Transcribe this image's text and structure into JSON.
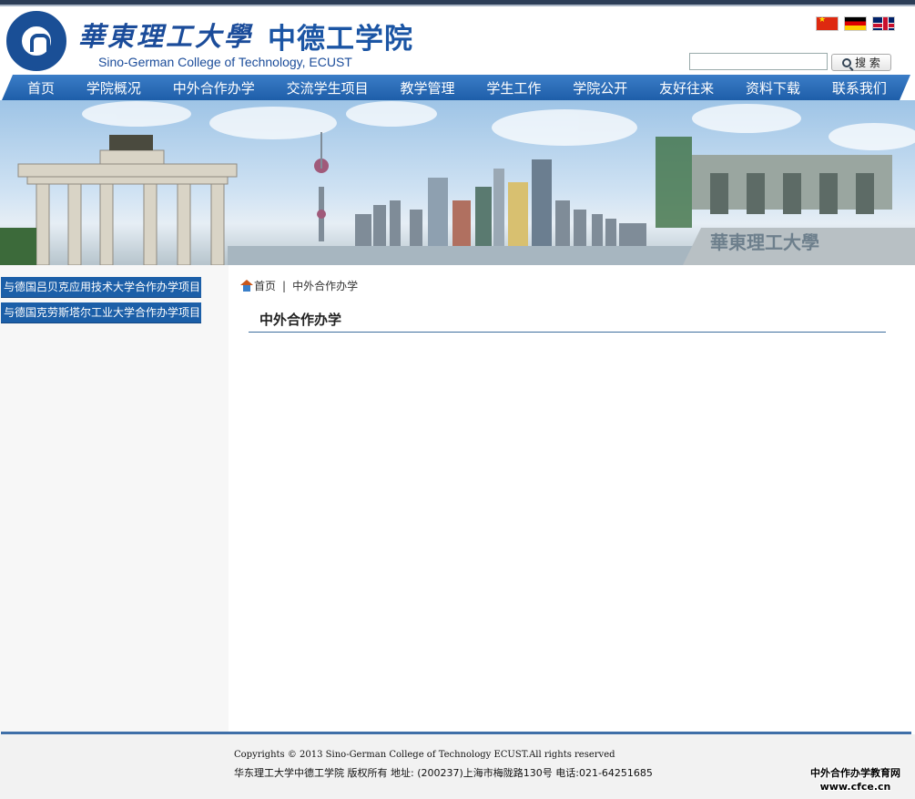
{
  "header": {
    "school_name": "華東理工大學",
    "college_name_cn": "中德工学院",
    "college_name_en": "Sino-German College of Technology, ECUST"
  },
  "languages": [
    "china-flag-icon",
    "germany-flag-icon",
    "uk-flag-icon"
  ],
  "search": {
    "value": "",
    "button_label": "搜 索"
  },
  "nav": {
    "items": [
      {
        "label": "首页"
      },
      {
        "label": "学院概况"
      },
      {
        "label": "中外合作办学"
      },
      {
        "label": "交流学生项目"
      },
      {
        "label": "教学管理"
      },
      {
        "label": "学生工作"
      },
      {
        "label": "学院公开"
      },
      {
        "label": "友好往来"
      },
      {
        "label": "资料下载"
      },
      {
        "label": "联系我们"
      }
    ]
  },
  "banner": {
    "sign_text": "華東理工大學"
  },
  "sidebar": {
    "items": [
      {
        "label": "与德国吕贝克应用技术大学合作办学项目"
      },
      {
        "label": "与德国克劳斯塔尔工业大学合作办学项目"
      }
    ]
  },
  "breadcrumb": {
    "home": "首页",
    "separator": "|",
    "current": "中外合作办学"
  },
  "main": {
    "title": "中外合作办学"
  },
  "footer": {
    "copyright": "Copyrights © 2013 Sino-German College of Technology ECUST.All rights reserved",
    "address": "华东理工大学中德工学院 版权所有 地址: (200237)上海市梅陇路130号 电话:021-64251685"
  },
  "watermark": {
    "line1": "中外合作办学教育网",
    "line2": "www.cfce.cn"
  },
  "colors": {
    "nav_blue": "#1e5ea9",
    "brand_blue": "#1b4c9a",
    "sidebar_link": "#1c5fa8"
  }
}
